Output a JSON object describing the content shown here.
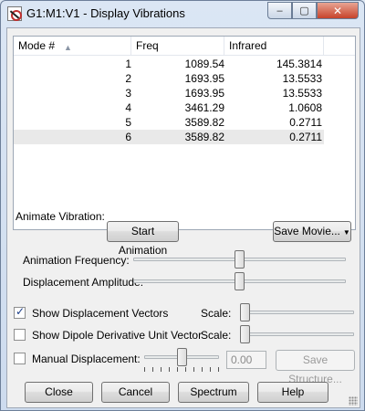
{
  "window": {
    "title": "G1:M1:V1 - Display Vibrations",
    "minimize_glyph": "–",
    "maximize_glyph": "▢",
    "close_glyph": "✕"
  },
  "table": {
    "columns": [
      "Mode #",
      "Freq",
      "Infrared"
    ],
    "sort_indicator": "▲",
    "rows": [
      {
        "mode": "1",
        "freq": "1089.54",
        "ir": "145.3814"
      },
      {
        "mode": "2",
        "freq": "1693.95",
        "ir": "13.5533"
      },
      {
        "mode": "3",
        "freq": "1693.95",
        "ir": "13.5533"
      },
      {
        "mode": "4",
        "freq": "3461.29",
        "ir": "1.0608"
      },
      {
        "mode": "5",
        "freq": "3589.82",
        "ir": "0.2711"
      },
      {
        "mode": "6",
        "freq": "3589.82",
        "ir": "0.2711"
      }
    ],
    "selected_row": 6
  },
  "animate": {
    "label": "Animate Vibration:",
    "start_button": "Start Animation",
    "save_movie_button": "Save Movie...",
    "frequency_label": "Animation Frequency:",
    "frequency_level": 0.5,
    "amplitude_label": "Displacement Amplitude:",
    "amplitude_level": 0.5
  },
  "options": {
    "show_vectors_label": "Show Displacement Vectors",
    "show_vectors_checked": true,
    "show_dipole_label": "Show Dipole Derivative Unit Vector",
    "show_dipole_checked": false,
    "scale_label": "Scale:",
    "vectors_scale_level": 0.0,
    "dipole_scale_level": 0.0,
    "manual_label": "Manual Displacement:",
    "manual_checked": false,
    "manual_level": 0.5,
    "manual_value": "0.00",
    "save_structure_button": "Save Structure..."
  },
  "buttons": {
    "close": "Close",
    "cancel": "Cancel",
    "spectrum": "Spectrum",
    "help": "Help"
  },
  "colors": {
    "selection": "#e9e9e9",
    "titlebar": "#dbe6f4",
    "close_button": "#c7432a"
  }
}
